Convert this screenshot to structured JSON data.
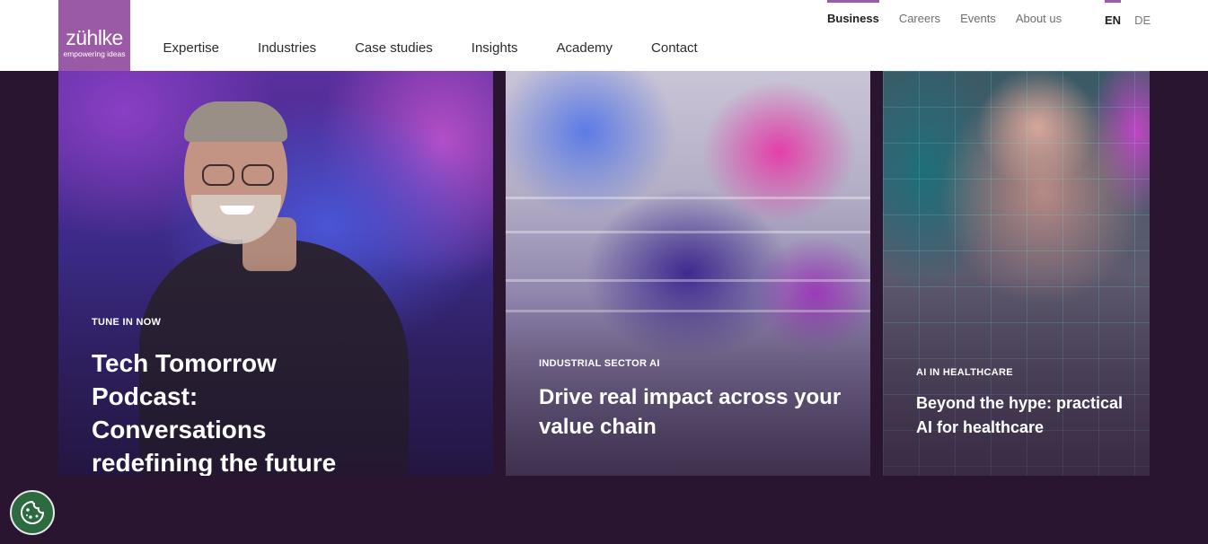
{
  "corner_mark": "o",
  "brand": {
    "name": "zühlke",
    "tagline": "empowering ideas",
    "color": "#9b5aa6"
  },
  "nav": {
    "items": [
      {
        "label": "Expertise"
      },
      {
        "label": "Industries"
      },
      {
        "label": "Case studies"
      },
      {
        "label": "Insights"
      },
      {
        "label": "Academy"
      },
      {
        "label": "Contact"
      }
    ]
  },
  "utility_nav": {
    "items": [
      {
        "label": "Business",
        "active": true
      },
      {
        "label": "Careers",
        "active": false
      },
      {
        "label": "Events",
        "active": false
      },
      {
        "label": "About us",
        "active": false
      }
    ]
  },
  "language": {
    "options": [
      {
        "label": "EN",
        "active": true
      },
      {
        "label": "DE",
        "active": false
      }
    ]
  },
  "cards": [
    {
      "eyebrow": "TUNE IN NOW",
      "headline": "Tech Tomorrow Podcast: Conversations redefining the future"
    },
    {
      "eyebrow": "INDUSTRIAL SECTOR AI",
      "headline": "Drive real impact across your value chain"
    },
    {
      "eyebrow": "AI IN HEALTHCARE",
      "headline": "Beyond the hype: practical AI for healthcare"
    }
  ],
  "page_background": "#2a1530",
  "cookie_button": {
    "icon": "cookie-icon",
    "color": "#2c6b3f"
  }
}
